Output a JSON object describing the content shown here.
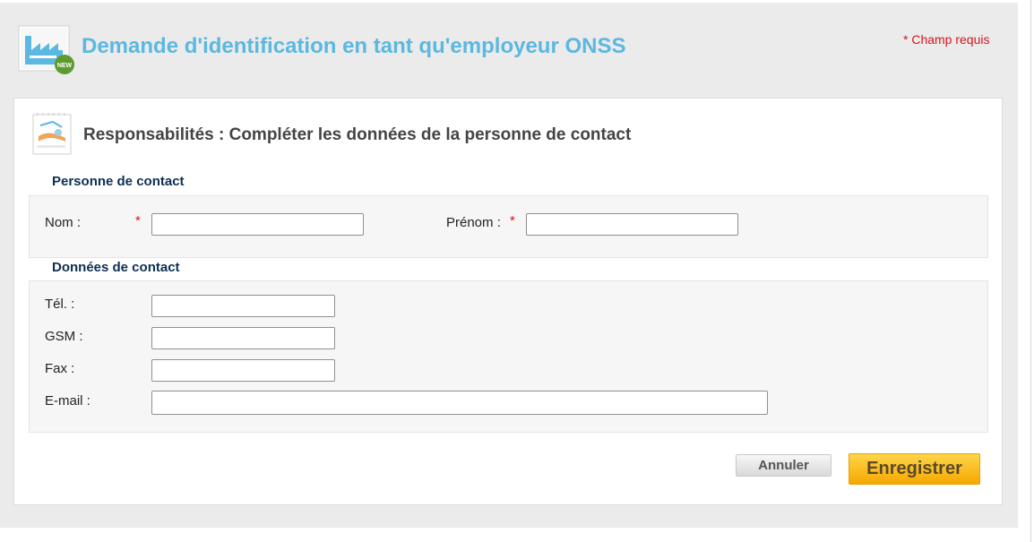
{
  "header": {
    "title": "Demande d'identification en tant qu'employeur ONSS",
    "required_note": "* Champ requis",
    "icon_badge": "NEW",
    "icon": "factory-new-icon"
  },
  "section": {
    "title": "Responsabilités : Compléter les données de la personne de contact",
    "icon": "contact-form-icon"
  },
  "person": {
    "group_title": "Personne de contact",
    "nom_label": "Nom :",
    "prenom_label": "Prénom :",
    "required_mark": "*",
    "nom_value": "",
    "prenom_value": ""
  },
  "contact": {
    "group_title": "Données de contact",
    "tel_label": "Tél. :",
    "gsm_label": "GSM :",
    "fax_label": "Fax :",
    "email_label": "E-mail :",
    "tel_value": "",
    "gsm_value": "",
    "fax_value": "",
    "email_value": ""
  },
  "buttons": {
    "cancel": "Annuler",
    "save": "Enregistrer"
  },
  "colors": {
    "title": "#5bb8e0",
    "required": "#d9131b",
    "group_title": "#0d2f52",
    "save_button": "#f6a800"
  }
}
